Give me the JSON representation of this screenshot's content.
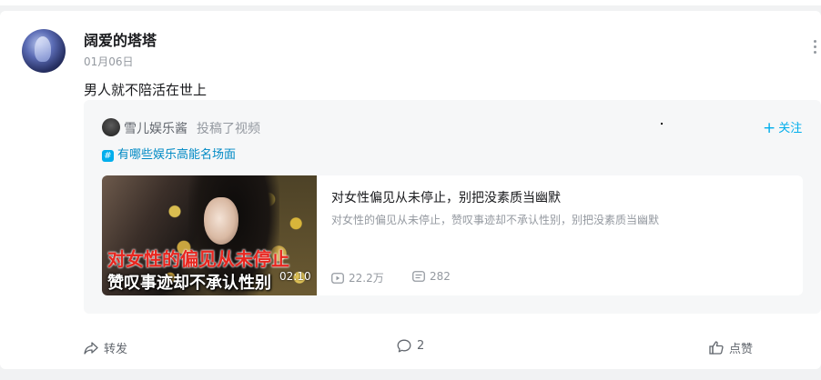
{
  "post": {
    "author": "阔爱的塔塔",
    "date": "01月06日",
    "text": "男人就不陪活在世上"
  },
  "repost": {
    "author": "雪儿娱乐酱",
    "action": "投稿了视频",
    "follow_label": "关注",
    "topic": "有哪些娱乐高能名场面",
    "video": {
      "title": "对女性偏见从未停止，别把没素质当幽默",
      "description": "对女性的偏见从未停止，赞叹事迹却不承认性别，别把没素质当幽默",
      "thumb_caption_top": "对女性的偏见从未停止",
      "thumb_caption_bottom": "赞叹事迹却不承认性别",
      "duration": "02:10",
      "views": "22.2万",
      "danmaku": "282"
    }
  },
  "footer": {
    "forward_label": "转发",
    "comment_count": "2",
    "like_label": "点赞"
  },
  "icons": {
    "more": "more-vertical-icon",
    "follow": "plus-icon",
    "topic": "hash-icon",
    "views": "play-icon",
    "danmaku": "danmaku-icon",
    "forward": "forward-icon",
    "comment": "comment-icon",
    "like": "thumbs-up-icon"
  },
  "colors": {
    "accent": "#00aeec",
    "topic": "#008ac5",
    "muted": "#9499a0",
    "caption_red": "#e8261f"
  }
}
